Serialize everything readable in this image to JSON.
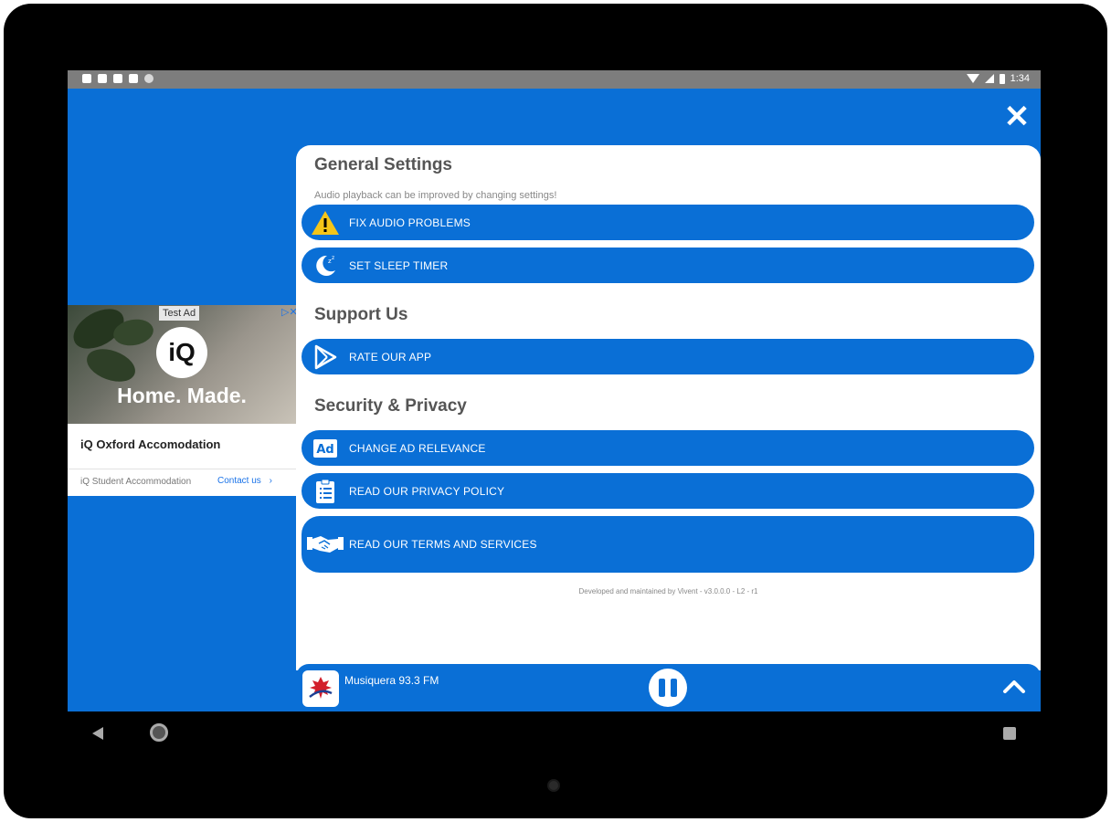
{
  "status_bar": {
    "time": "1:34"
  },
  "ad": {
    "tag": "Test Ad",
    "logo_text": "iQ",
    "headline": "Home. Made.",
    "title": "iQ Oxford Accomodation",
    "advertiser": "iQ Student Accommodation",
    "cta": "Contact us",
    "cta_chevron": "›"
  },
  "close_button": "✕",
  "settings": {
    "general": {
      "title": "General Settings",
      "subtitle": "Audio playback can be improved by changing settings!",
      "items": [
        {
          "label": "FIX AUDIO PROBLEMS",
          "icon": "warning-icon"
        },
        {
          "label": "SET SLEEP TIMER",
          "icon": "moon-icon"
        }
      ]
    },
    "support": {
      "title": "Support Us",
      "items": [
        {
          "label": "RATE OUR APP",
          "icon": "play-store-icon"
        }
      ]
    },
    "security": {
      "title": "Security & Privacy",
      "items": [
        {
          "label": "CHANGE AD RELEVANCE",
          "icon": "ad-icon"
        },
        {
          "label": "READ OUR PRIVACY POLICY",
          "icon": "clipboard-icon"
        },
        {
          "label": "READ OUR TERMS AND SERVICES",
          "icon": "handshake-icon"
        }
      ]
    },
    "footer": "Developed and maintained by Vivent - v3.0.0.0 - L2 - r1"
  },
  "player": {
    "station": "Musiquera 93.3 FM",
    "state": "playing"
  },
  "colors": {
    "accent": "#0a6fd6",
    "warning": "#f5c518"
  }
}
